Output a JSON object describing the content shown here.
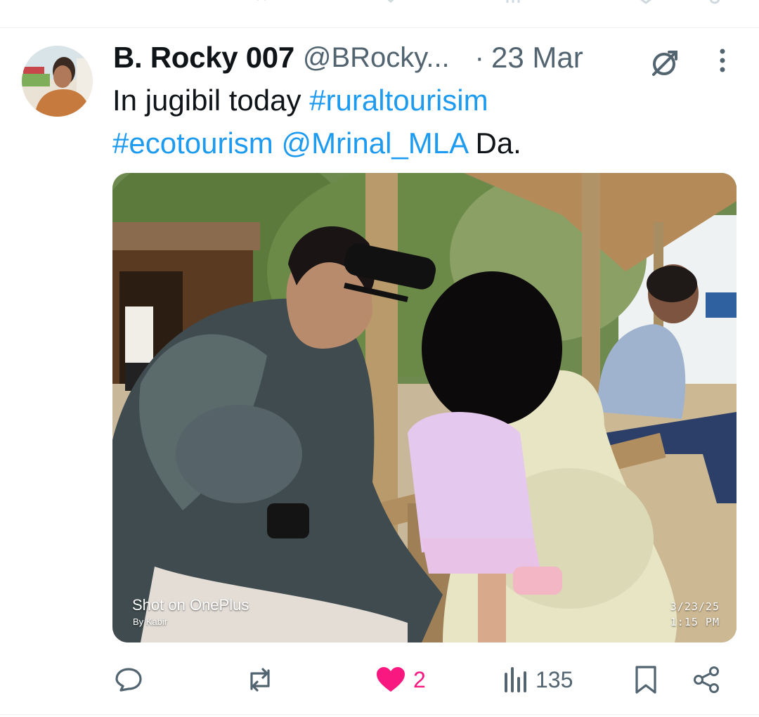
{
  "tweet": {
    "display_name": "B. Rocky 007",
    "handle": "@BRocky...",
    "separator": "·",
    "date": "23 Mar",
    "text_plain": "In jugibil today ",
    "hashtag_1": "#ruraltourisim",
    "hashtag_2": "#ecotourism",
    "mention": "@Mrinal_MLA",
    "text_end": " Da.",
    "photo": {
      "watermark_main": "Shot on OnePlus",
      "watermark_by": "By Kabir",
      "stamp_date": "3/23/25",
      "stamp_time": "1:15 PM"
    },
    "actions": {
      "replies": "",
      "reposts": "",
      "likes": "2",
      "views": "135"
    }
  },
  "colors": {
    "link": "#1d9bf0",
    "like": "#f91880",
    "muted": "#536471",
    "text": "#0f1419"
  },
  "icons": [
    "reply-icon",
    "repost-icon",
    "heart-icon",
    "views-icon",
    "bookmark-icon",
    "share-icon",
    "grok-icon",
    "more-icon"
  ]
}
